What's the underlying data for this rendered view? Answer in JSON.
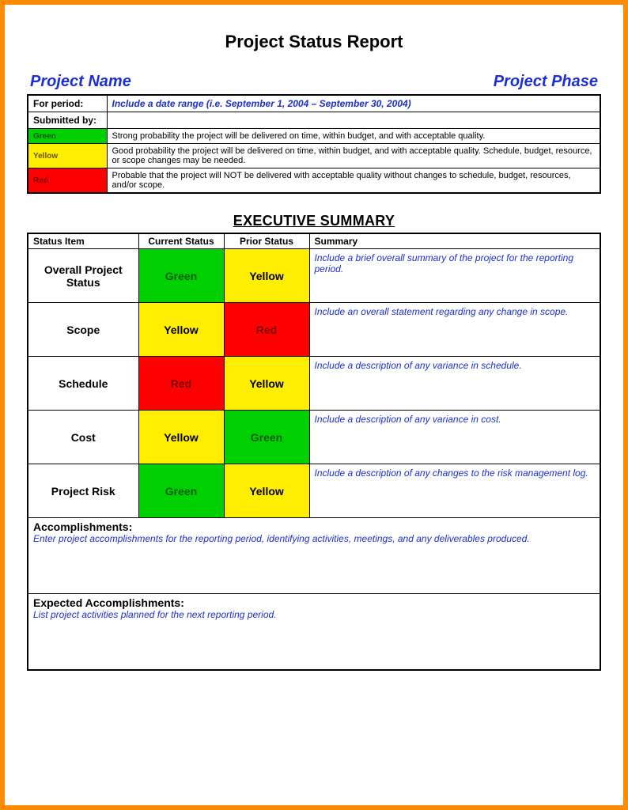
{
  "title": "Project Status Report",
  "header": {
    "project_name": "Project Name",
    "project_phase": "Project Phase"
  },
  "meta": {
    "for_period_label": "For period:",
    "for_period_value": "Include a date range (i.e. September 1, 2004 – September 30, 2004)",
    "submitted_by_label": "Submitted by:",
    "legend": [
      {
        "name": "Green",
        "class": "g",
        "desc": "Strong probability the project will be delivered on time, within budget, and with acceptable quality."
      },
      {
        "name": "Yellow",
        "class": "y",
        "desc": "Good probability the project will be delivered on time, within budget, and with acceptable quality. Schedule, budget, resource, or scope changes may be needed."
      },
      {
        "name": "Red",
        "class": "r",
        "desc": "Probable that the project will NOT be delivered with acceptable quality without changes to schedule, budget, resources, and/or scope."
      }
    ]
  },
  "exec_title": "EXECUTIVE SUMMARY",
  "exec_headers": {
    "status_item": "Status Item",
    "current": "Current Status",
    "prior": "Prior Status",
    "summary": "Summary"
  },
  "exec_rows": [
    {
      "item": "Overall Project Status",
      "current": "Green",
      "current_class": "g2",
      "prior": "Yellow",
      "prior_class": "y2",
      "summary": "Include a brief overall summary of the project for the reporting period."
    },
    {
      "item": "Scope",
      "current": "Yellow",
      "current_class": "y2",
      "prior": "Red",
      "prior_class": "r2",
      "summary": "Include an overall statement regarding any change in scope."
    },
    {
      "item": "Schedule",
      "current": "Red",
      "current_class": "r2",
      "prior": "Yellow",
      "prior_class": "y2",
      "summary": "Include a description of any variance in schedule."
    },
    {
      "item": "Cost",
      "current": "Yellow",
      "current_class": "y2",
      "prior": "Green",
      "prior_class": "g2",
      "summary": "Include a description of any variance in cost."
    },
    {
      "item": "Project Risk",
      "current": "Green",
      "current_class": "g2",
      "prior": "Yellow",
      "prior_class": "y2",
      "summary": "Include a description of any changes to the risk management log."
    }
  ],
  "sections": {
    "accomplishments_label": "Accomplishments:",
    "accomplishments_hint": "Enter project accomplishments for the reporting period, identifying activities, meetings, and any deliverables produced.",
    "expected_label": "Expected Accomplishments:",
    "expected_hint": "List project activities planned for the next reporting period."
  }
}
